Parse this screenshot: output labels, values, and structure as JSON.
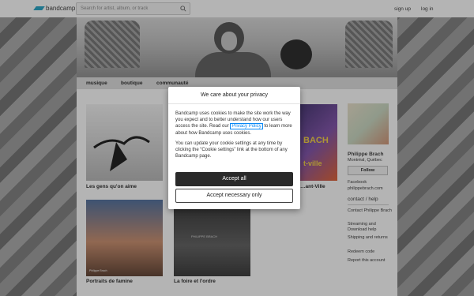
{
  "header": {
    "logo_text": "bandcamp",
    "search_placeholder": "Search for artist, album, or track",
    "signup_label": "sign up",
    "login_label": "log in"
  },
  "nav": {
    "items": [
      "musique",
      "boutique",
      "communauté"
    ]
  },
  "albums": [
    {
      "title": "Les gens qu'on aime"
    },
    {
      "title": "…ant-Ville"
    },
    {
      "title": "Portraits de famine"
    },
    {
      "title": "La foire et l'ordre"
    }
  ],
  "album_art_text": {
    "art3_lines": [
      "BACH",
      "t-ville"
    ],
    "art4_caption": "Philippe Brach",
    "art5_caption": "PHILIPPE BRACH"
  },
  "sidebar": {
    "artist_name": "Philippe Brach",
    "location": "Montréal, Québec",
    "follow_label": "Follow",
    "links": [
      "Facebook",
      "philippebrach.com"
    ],
    "contact_heading": "contact / help",
    "help_links": [
      "Contact Philippe Brach",
      "Streaming and Download help",
      "Shipping and returns",
      "Redeem code",
      "Report this account"
    ]
  },
  "modal": {
    "title": "We care about your privacy",
    "para1_before": "Bandcamp uses cookies to make the site work the way you expect and to better understand how our users access the site. Read our ",
    "privacy_link": "Privacy Policy",
    "para1_after": " to learn more about how Bandcamp uses cookies.",
    "para2": "You can update your cookie settings at any time by clicking the “Cookie settings” link at the bottom of any Bandcamp page.",
    "accept_all_label": "Accept all",
    "accept_necessary_label": "Accept necessary only"
  },
  "colors": {
    "logo_accent": "#1da0c3",
    "link_blue": "#0687f5",
    "accept_bg": "#2a2a2a"
  }
}
